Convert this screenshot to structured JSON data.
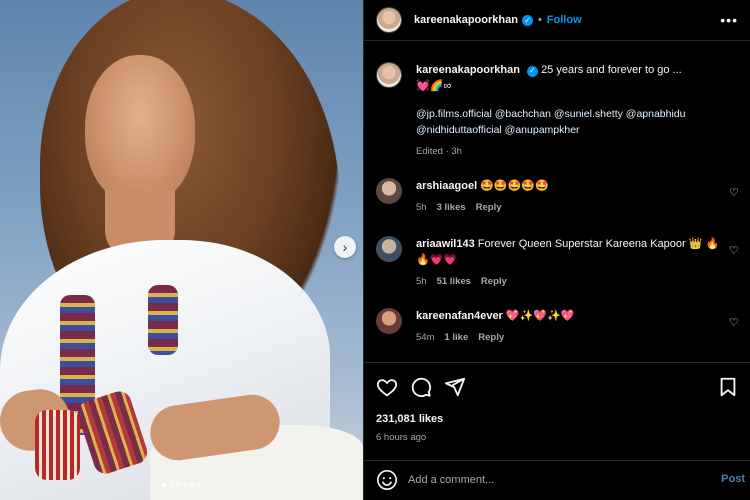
{
  "header": {
    "username": "kareenakapoorkhan",
    "separator": "•",
    "follow_label": "Follow",
    "more_label": "•••"
  },
  "caption": {
    "username": "kareenakapoorkhan",
    "text": "25 years and forever to go ...",
    "emoji_line": "💓🌈∞",
    "mentions_line1": "@jp.films.official @bachchan @suniel.shetty @apnabhidu",
    "mentions_line2": "@nidhiduttaofficial @anupampkher",
    "meta": "Edited · 3h"
  },
  "comments": [
    {
      "user": "arshiaagoel",
      "text": "🤩🤩🤩🤩🤩",
      "text2": "",
      "time": "5h",
      "likes": "3 likes",
      "reply": "Reply",
      "avatar_color": "#5a4a44"
    },
    {
      "user": "ariaawil143",
      "text": "Forever Queen Superstar Kareena Kapoor 👑 🔥",
      "text2": "🔥💗💗",
      "time": "5h",
      "likes": "51 likes",
      "reply": "Reply",
      "avatar_color": "#3d4f63"
    },
    {
      "user": "kareenafan4ever",
      "text": "💖✨💖✨💖",
      "text2": "",
      "time": "54m",
      "likes": "1 like",
      "reply": "Reply",
      "avatar_color": "#6b3a3a"
    }
  ],
  "stats": {
    "likes": "231,081 likes",
    "posted": "6 hours ago"
  },
  "add_comment": {
    "placeholder": "Add a comment...",
    "post_label": "Post"
  },
  "carousel": {
    "slides": 6,
    "active": 0
  },
  "colors": {
    "accent": "#0095f6",
    "background": "#000000",
    "muted": "#a8a8a8"
  }
}
